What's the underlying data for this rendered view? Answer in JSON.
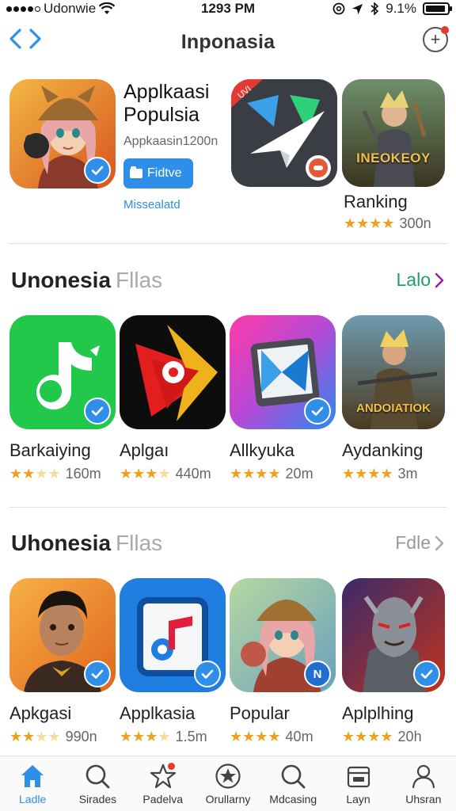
{
  "status": {
    "carrier": "Udonwie",
    "time": "1293 PM",
    "battery": "9.1%",
    "battery_level": 0.91
  },
  "nav": {
    "title": "Inponasia"
  },
  "featured": {
    "title": "Applkaasi Populsia",
    "subtitle": "Appkaasin1200n",
    "button_label": "Fidtve",
    "link_label": "Missealatd",
    "side_app_name": "Ranking",
    "side_app_rating_text": "300n",
    "side_app_rating": 4,
    "side_app_banner": "INEOKEOY",
    "promo_tag": "UVI"
  },
  "sections": [
    {
      "title": "Unonesia",
      "title_muted": "Fllas",
      "link_label": "Lalo",
      "link_color": "#1f9d6a",
      "apps": [
        {
          "name": "Barkaiying",
          "rating_text": "160m",
          "rating": 2.5,
          "icon": "music-note-icon"
        },
        {
          "name": "Aplgaı",
          "rating_text": "440m",
          "rating": 3,
          "icon": "red-play-icon"
        },
        {
          "name": "Allkyuka",
          "rating_text": "20m",
          "rating": 4,
          "icon": "gradient-window-icon"
        },
        {
          "name": "Aydanking",
          "rating_text": "3m",
          "rating": 4,
          "icon": "warrior-game-icon",
          "banner": "ANDOIATIOK"
        }
      ]
    },
    {
      "title": "Uhonesia",
      "title_muted": "Fllas",
      "link_label": "Fdle",
      "link_color": "#999999",
      "apps": [
        {
          "name": "Apkgasi",
          "rating_text": "990n",
          "rating": 2.5,
          "icon": "portrait-icon"
        },
        {
          "name": "Applkasia",
          "rating_text": "1.5m",
          "rating": 3,
          "icon": "music-tablet-icon"
        },
        {
          "name": "Popular",
          "rating_text": "40m",
          "rating": 4,
          "icon": "girl-character-icon",
          "badge": "N"
        },
        {
          "name": "Aplplhing",
          "rating_text": "20h",
          "rating": 4,
          "icon": "armored-hero-icon"
        }
      ]
    }
  ],
  "tabs": [
    {
      "label": "Ladle",
      "icon": "home-icon",
      "active": true
    },
    {
      "label": "Sirades",
      "icon": "search-icon",
      "active": false
    },
    {
      "label": "Padelva",
      "icon": "star-icon",
      "active": false,
      "badge": true
    },
    {
      "label": "Orullarny",
      "icon": "star-circle-icon",
      "active": false
    },
    {
      "label": "Mdcasing",
      "icon": "search-icon",
      "active": false
    },
    {
      "label": "Layn",
      "icon": "wallet-icon",
      "active": false
    },
    {
      "label": "Uhsran",
      "icon": "person-icon",
      "active": false
    }
  ],
  "colors": {
    "accent": "#2f8ee8",
    "star": "#f0a020"
  }
}
